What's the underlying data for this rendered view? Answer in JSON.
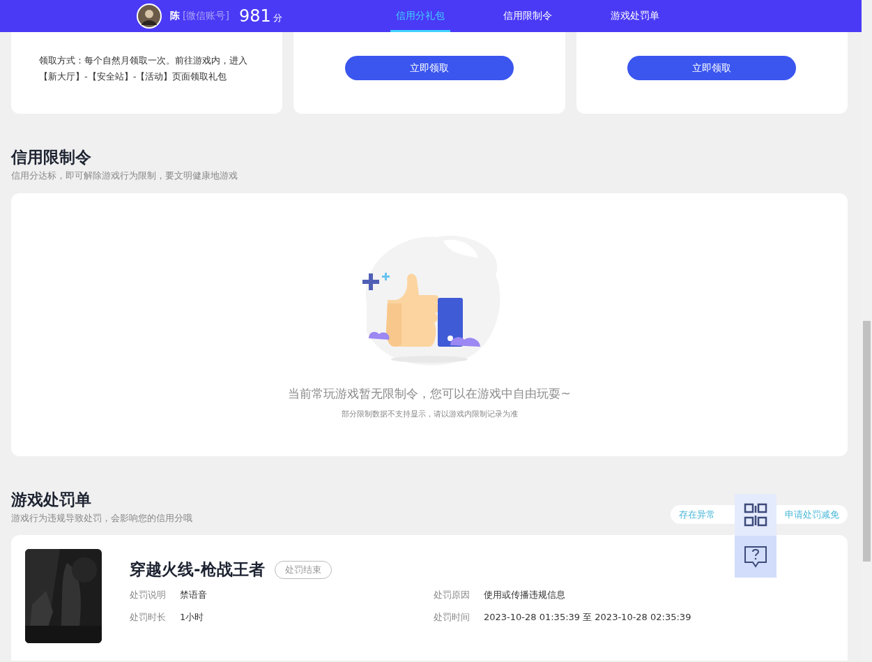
{
  "header": {
    "user": {
      "name": "陈",
      "account": "[微信账号]",
      "score": "981",
      "score_unit": "分"
    },
    "tabs": [
      {
        "label": "信用分礼包",
        "selected": true
      },
      {
        "label": "信用限制令",
        "selected": false
      },
      {
        "label": "游戏处罚单",
        "selected": false
      }
    ]
  },
  "gift_cards": [
    {
      "kind": "text",
      "text": "领取方式：每个自然月领取一次。前往游戏内，进入【新大厅】-【安全站】-【活动】页面领取礼包"
    },
    {
      "kind": "button",
      "button": "立即领取"
    },
    {
      "kind": "button",
      "button": "立即领取"
    }
  ],
  "restrictions": {
    "title": "信用限制令",
    "subtitle": "信用分达标，即可解除游戏行为限制，要文明健康地游戏",
    "empty_message": "当前常玩游戏暂无限制令，您可以在游戏中自由玩耍~",
    "empty_note": "部分限制数据不支持显示，请以游戏内限制记录为准"
  },
  "penalties": {
    "title": "游戏处罚单",
    "subtitle": "游戏行为违规导致处罚，会影响您的信用分哦",
    "actions": [
      "存在异常",
      "申请处罚减免"
    ],
    "records": [
      {
        "game": "穿越火线-枪战王者",
        "status": "处罚结束",
        "fields": [
          {
            "label": "处罚说明",
            "value": "禁语音"
          },
          {
            "label": "处罚原因",
            "value": "使用或传播违规信息"
          },
          {
            "label": "处罚时长",
            "value": "1小时"
          },
          {
            "label": "处罚时间",
            "value": "2023-10-28 01:35:39 至 2023-10-28 02:35:39"
          }
        ]
      }
    ]
  }
}
